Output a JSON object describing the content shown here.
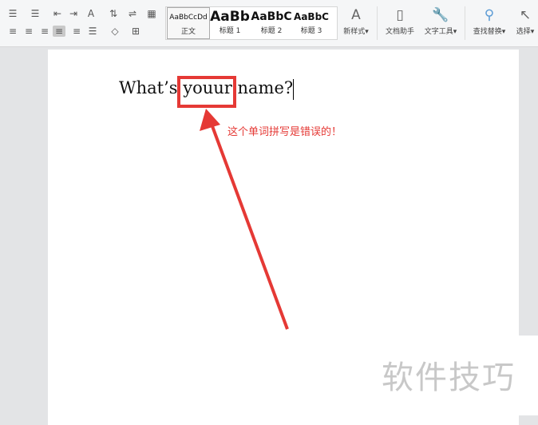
{
  "toolbar": {
    "styles": [
      {
        "preview": "AaBbCcDd",
        "label": "正文"
      },
      {
        "preview": "AaBb",
        "label": "标题 1"
      },
      {
        "preview": "AaBbC",
        "label": "标题 2"
      },
      {
        "preview": "AaBbC",
        "label": "标题 3"
      }
    ],
    "new_style": "新样式",
    "doc_assistant": "文档助手",
    "text_tools": "文字工具",
    "find_replace": "查找替换",
    "select": "选择"
  },
  "document": {
    "text_before": "What’s ",
    "highlighted_word": "youur",
    "text_after": " name?"
  },
  "annotation": {
    "text": "这个单词拼写是错误的！",
    "color": "#e53935"
  },
  "watermark": "软件技巧"
}
